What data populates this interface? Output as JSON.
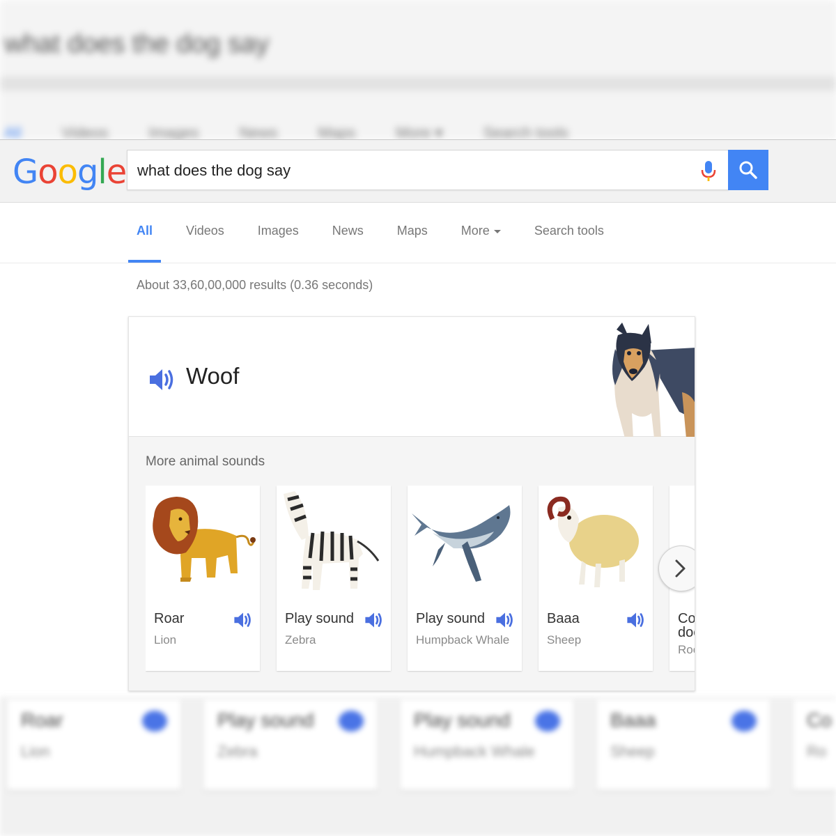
{
  "background": {
    "top_query": "what does the dog say",
    "top_tabs": [
      "All",
      "Videos",
      "Images",
      "News",
      "Maps",
      "More ▾",
      "Search tools"
    ],
    "bottom_cards": [
      {
        "label": "Roar",
        "animal": "Lion"
      },
      {
        "label": "Play sound",
        "animal": "Zebra"
      },
      {
        "label": "Play sound",
        "animal": "Humpback Whale"
      },
      {
        "label": "Baaa",
        "animal": "Sheep"
      },
      {
        "label": "Co",
        "animal": "Ro"
      }
    ]
  },
  "header": {
    "logo_letters": [
      "G",
      "o",
      "o",
      "g",
      "l",
      "e"
    ],
    "search_query": "what does the dog say",
    "mic_icon": "mic-icon",
    "search_icon": "magnifier-icon"
  },
  "tabs": [
    {
      "label": "All",
      "active": true
    },
    {
      "label": "Videos"
    },
    {
      "label": "Images"
    },
    {
      "label": "News"
    },
    {
      "label": "Maps"
    },
    {
      "label": "More"
    },
    {
      "label": "Search tools"
    }
  ],
  "results_stats": "About 33,60,00,000 results (0.36 seconds)",
  "answer": {
    "sound": "Woof",
    "speaker_icon": "speaker-icon",
    "more_title": "More animal sounds",
    "animals": [
      {
        "label": "Roar",
        "name": "Lion"
      },
      {
        "label": "Play sound",
        "name": "Zebra"
      },
      {
        "label": "Play sound",
        "name": "Humpback Whale"
      },
      {
        "label": "Baaa",
        "name": "Sheep"
      },
      {
        "label": "Co",
        "label_line2": "doo",
        "name": "Roo"
      }
    ],
    "next_icon": "chevron-right-icon"
  },
  "colors": {
    "google_blue": "#4285f4",
    "google_red": "#ea4335",
    "google_yellow": "#fbbc05",
    "google_green": "#34a853",
    "speaker_blue": "#4a6fe0"
  }
}
